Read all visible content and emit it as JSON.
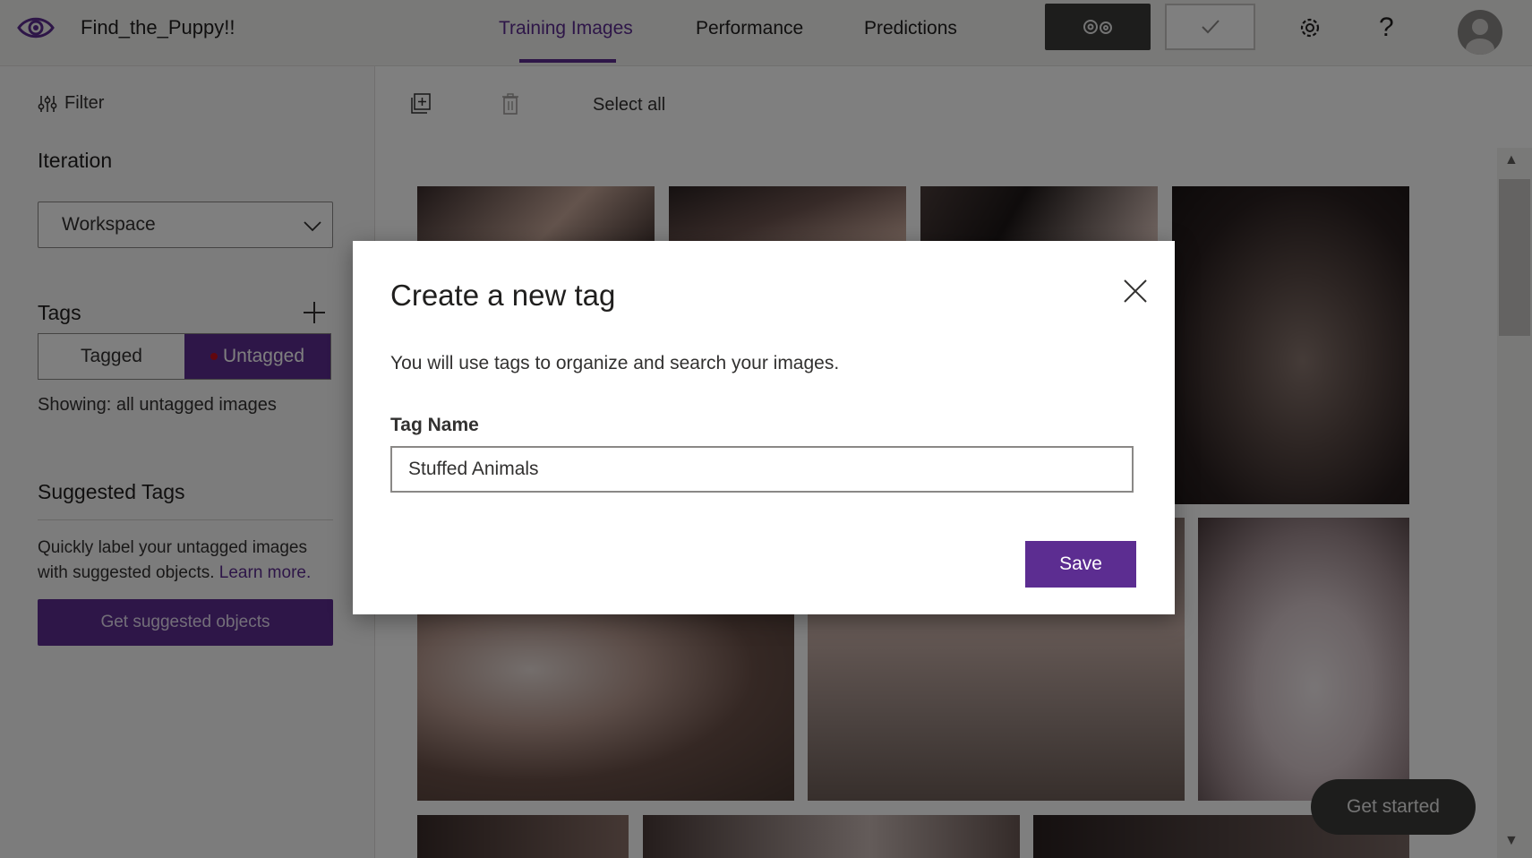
{
  "header": {
    "project_name": "Find_the_Puppy!!",
    "tabs": [
      {
        "label": "Training Images",
        "active": true
      },
      {
        "label": "Performance",
        "active": false
      },
      {
        "label": "Predictions",
        "active": false
      }
    ],
    "icons": {
      "logo": "eye-icon",
      "train": "gears-icon",
      "quick_test": "check-icon",
      "settings": "gear-icon",
      "help": "question-icon",
      "account": "avatar-icon"
    },
    "help_glyph": "?"
  },
  "sidebar": {
    "filter_label": "Filter",
    "iteration_heading": "Iteration",
    "iteration_value": "Workspace",
    "tags_heading": "Tags",
    "toggle": {
      "tagged": "Tagged",
      "untagged": "Untagged",
      "selected": "untagged"
    },
    "showing_text": "Showing: all untagged images",
    "suggested_heading": "Suggested Tags",
    "suggested_desc": "Quickly label your untagged images with suggested objects.",
    "learn_more": "Learn more.",
    "suggest_button": "Get suggested objects"
  },
  "toolbar": {
    "add_images_icon": "add-images-icon",
    "delete_icon": "trash-icon",
    "select_all": "Select all"
  },
  "get_started": "Get started",
  "modal": {
    "title": "Create a new tag",
    "description": "You will use tags to organize and search your images.",
    "field_label": "Tag Name",
    "field_value": "Stuffed Animals",
    "save_label": "Save"
  },
  "colors": {
    "accent": "#5c2d91",
    "overlay": "rgba(0,0,0,0.5)",
    "untagged_dot": "#c50f1f"
  }
}
